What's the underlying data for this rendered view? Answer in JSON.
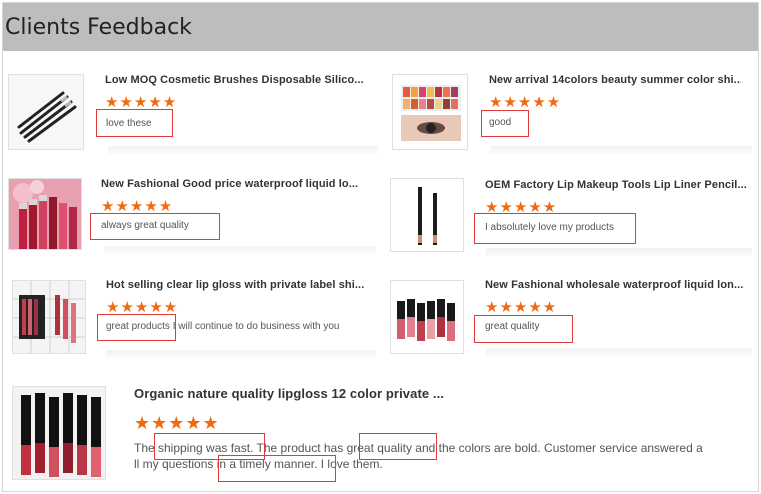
{
  "section": {
    "title": "Clients Feedback"
  },
  "colors": {
    "star": "#f26a10",
    "highlight": "#e13a3a",
    "header_bg": "#bdbdbd"
  },
  "reviews": [
    {
      "product": "Low MOQ Cosmetic Brushes Disposable Silico...",
      "rating": 5,
      "stars": "★★★★★",
      "comment": "love these",
      "image": "makeup-brushes-photo"
    },
    {
      "product": "New arrival 14colors beauty summer color shi...",
      "rating": 5,
      "stars": "★★★★★",
      "comment": "good",
      "image": "eyeshadow-palette-photo"
    },
    {
      "product": "New Fashional Good price waterproof liquid lo...",
      "rating": 5,
      "stars": "★★★★★",
      "comment": "always great quality",
      "image": "liquid-lipstick-tubes-photo"
    },
    {
      "product": "OEM Factory Lip Makeup Tools Lip Liner Pencil...",
      "rating": 5,
      "stars": "★★★★★",
      "comment": "I absolutely love my products",
      "image": "lip-liner-pencils-photo"
    },
    {
      "product": "Hot selling clear lip gloss with private label shi...",
      "rating": 5,
      "stars": "★★★★★",
      "comment_highlight": "great products",
      "comment_rest": " I will continue to do business with you",
      "image": "lip-gloss-set-photo"
    },
    {
      "product": "New Fashional wholesale waterproof liquid lon...",
      "rating": 5,
      "stars": "★★★★★",
      "comment": "great quality",
      "image": "lipstick-row-photo"
    },
    {
      "product": "Organic nature quality lipgloss 12 color private ...",
      "rating": 5,
      "stars": "★★★★★",
      "comment_line1": "The shipping was fast. The product has great quality and the colors are bold. Customer service answered a",
      "comment_line2": "ll my questions in a timely manner. I love them.",
      "image": "lipgloss-collection-photo"
    }
  ]
}
